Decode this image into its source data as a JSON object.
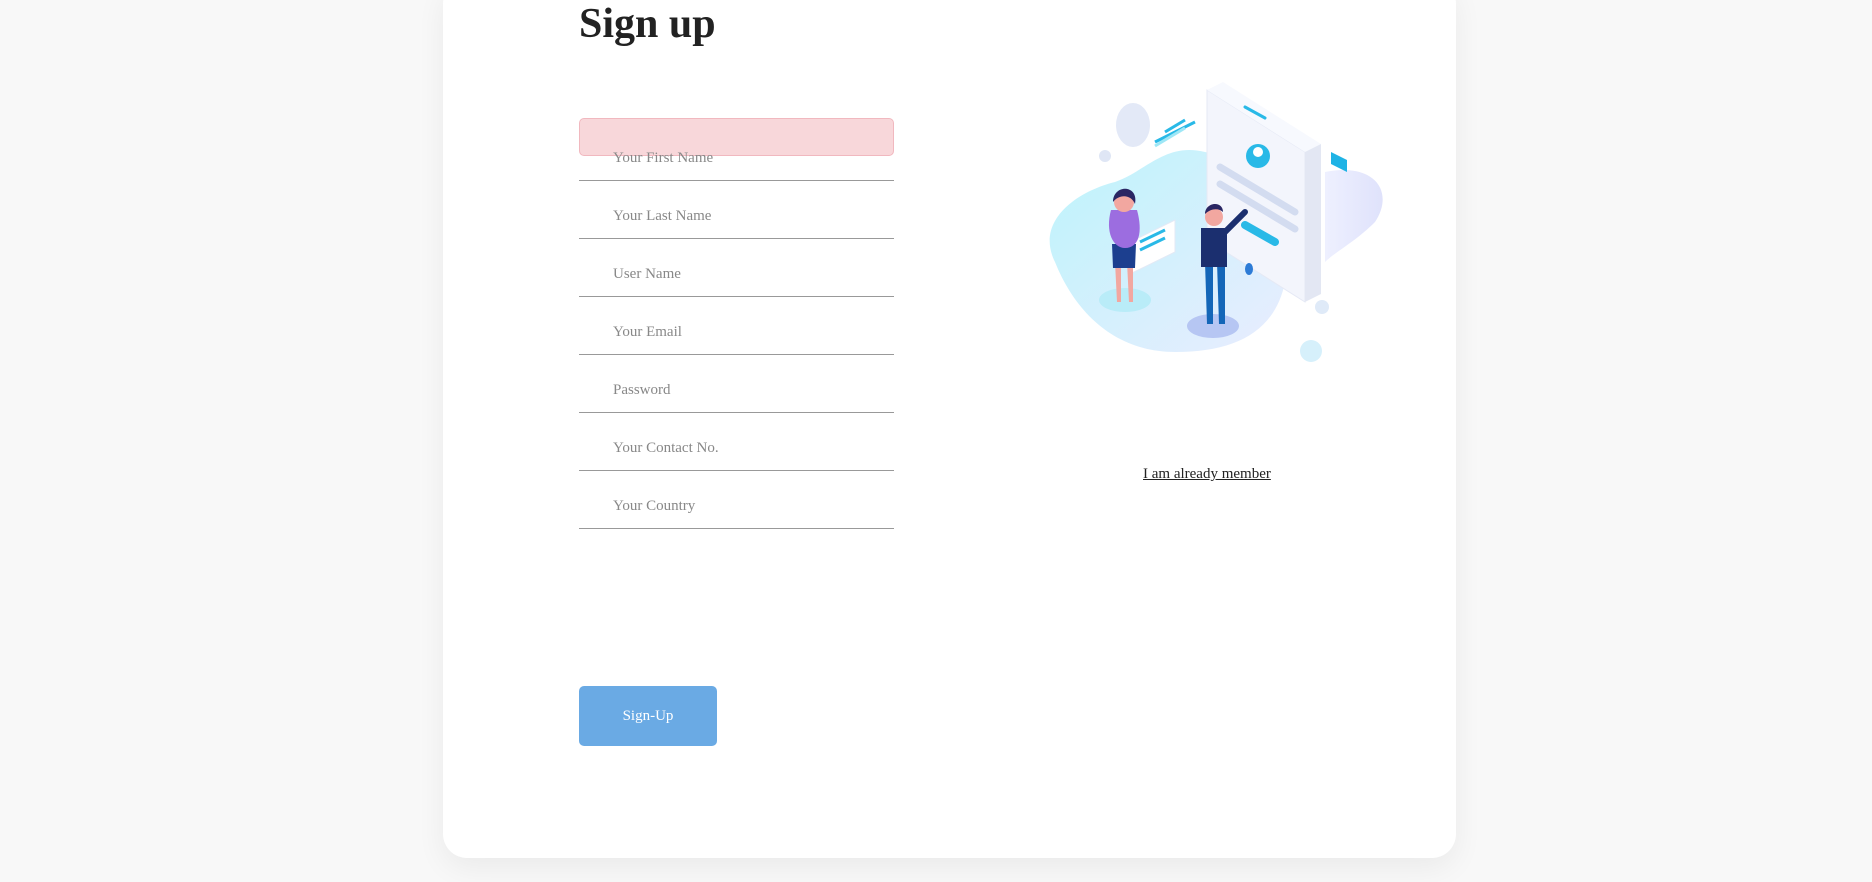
{
  "form": {
    "title": "Sign up",
    "alert_text": "",
    "fields": [
      {
        "name": "first-name-input",
        "placeholder": "Your First Name",
        "value": ""
      },
      {
        "name": "last-name-input",
        "placeholder": "Your Last Name",
        "value": ""
      },
      {
        "name": "username-input",
        "placeholder": "User Name",
        "value": ""
      },
      {
        "name": "email-input",
        "placeholder": "Your Email",
        "value": ""
      },
      {
        "name": "password-input",
        "placeholder": "Password",
        "value": ""
      },
      {
        "name": "contact-input",
        "placeholder": "Your Contact No.",
        "value": ""
      },
      {
        "name": "country-input",
        "placeholder": "Your Country",
        "value": ""
      }
    ],
    "submit_label": "Sign-Up"
  },
  "side": {
    "illustration_icon": "signup-illustration",
    "member_link": "I am already member"
  },
  "colors": {
    "page_background": "#f8f8f8",
    "alert_background": "#f8d7da",
    "button_background": "#6aaae4"
  }
}
